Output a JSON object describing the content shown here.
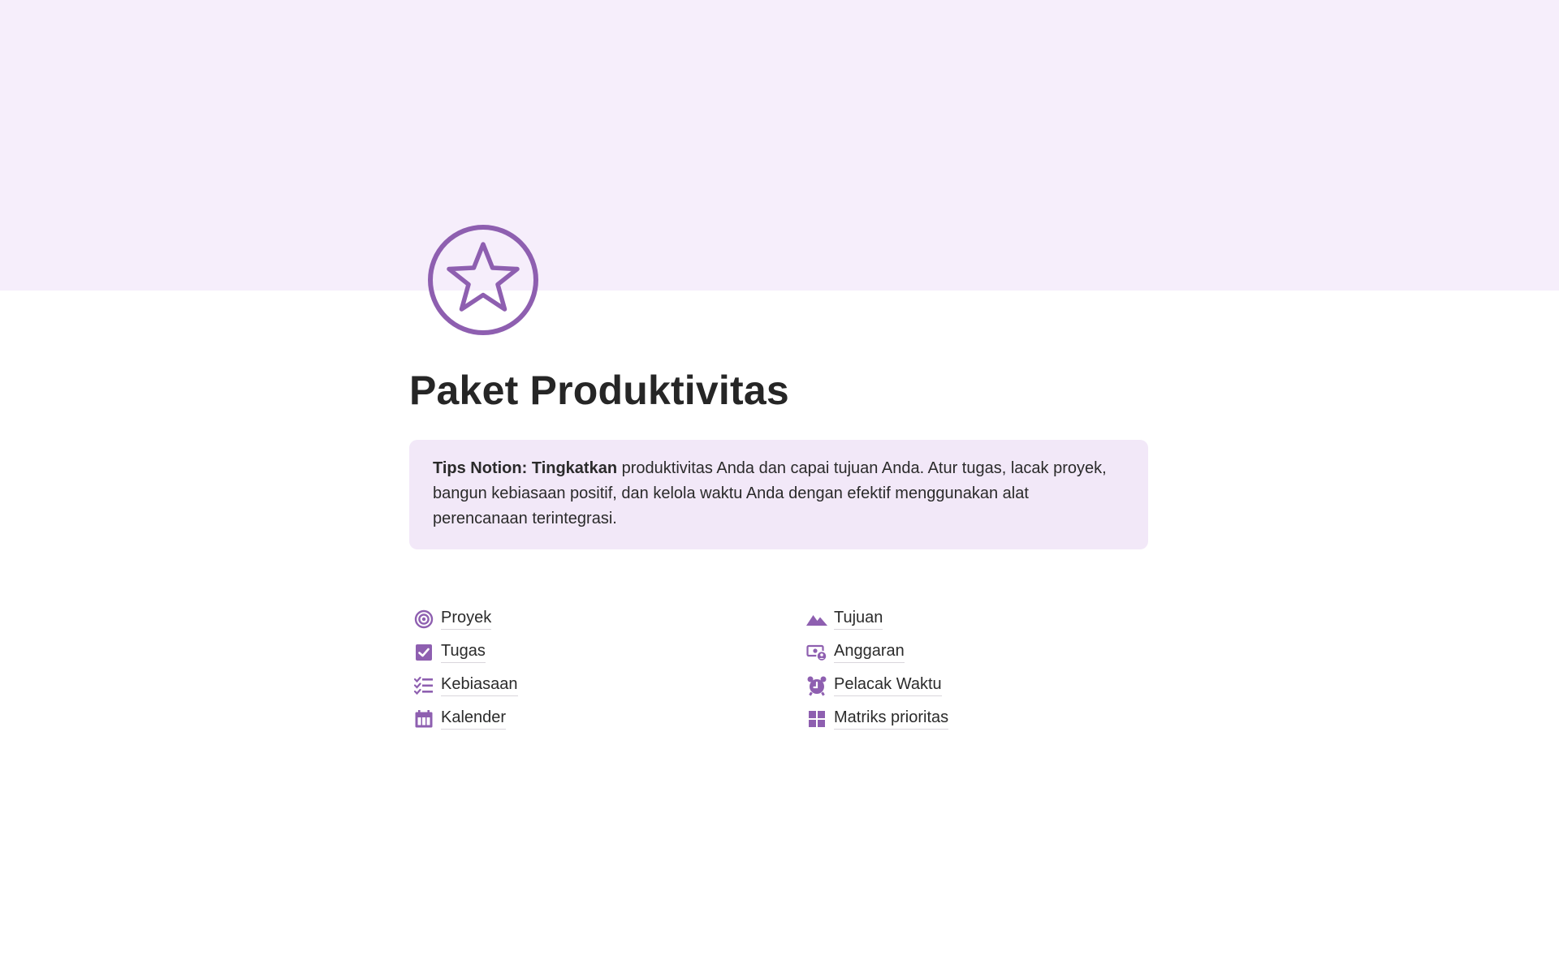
{
  "page": {
    "title": "Paket Produktivitas",
    "icon": "star-circle-icon",
    "accent_color": "#8e5fb0",
    "cover_color": "#f6eefb"
  },
  "callout": {
    "bold_text": "Tips Notion: Tingkatkan",
    "text": " produktivitas Anda dan capai tujuan Anda. Atur tugas, lacak proyek, bangun kebiasaan positif, dan kelola waktu Anda dengan efektif menggunakan alat perencanaan terintegrasi.",
    "background": "#f2e8f8"
  },
  "links": {
    "left": [
      {
        "label": "Proyek",
        "icon": "target-icon"
      },
      {
        "label": "Tugas",
        "icon": "checkbox-icon"
      },
      {
        "label": "Kebiasaan",
        "icon": "checklist-icon"
      },
      {
        "label": "Kalender",
        "icon": "calendar-icon"
      }
    ],
    "right": [
      {
        "label": "Tujuan",
        "icon": "mountain-icon"
      },
      {
        "label": "Anggaran",
        "icon": "money-icon"
      },
      {
        "label": "Pelacak Waktu",
        "icon": "alarm-clock-icon"
      },
      {
        "label": "Matriks prioritas",
        "icon": "grid-icon"
      }
    ]
  }
}
